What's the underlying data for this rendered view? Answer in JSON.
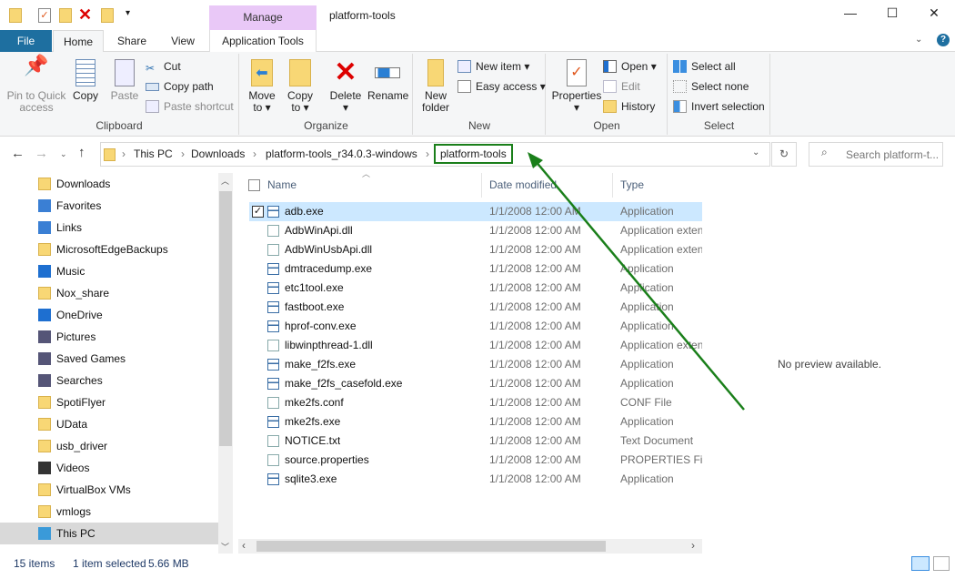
{
  "window": {
    "title": "platform-tools",
    "context_tab": "Manage",
    "minimize": "—",
    "maximize": "☐",
    "close": "✕"
  },
  "tabs": [
    {
      "label": "File"
    },
    {
      "label": "Home"
    },
    {
      "label": "Share"
    },
    {
      "label": "View"
    },
    {
      "label": "Application Tools"
    }
  ],
  "ribbon": {
    "clipboard": {
      "label": "Clipboard",
      "pin": "Pin to Quick access",
      "pin1": "Pin to Quick",
      "pin2": "access",
      "copy": "Copy",
      "paste": "Paste",
      "cut": "Cut",
      "copy_path": "Copy path",
      "paste_shortcut": "Paste shortcut"
    },
    "organize": {
      "label": "Organize",
      "move1": "Move",
      "move2": "to ▾",
      "copy1": "Copy",
      "copy2": "to ▾",
      "delete": "Delete",
      "delete_arrow": "▾",
      "rename": "Rename"
    },
    "new": {
      "label": "New",
      "new1": "New",
      "new2": "folder",
      "new_item": "New item ▾",
      "easy_access": "Easy access ▾"
    },
    "open": {
      "label": "Open",
      "properties": "Properties",
      "prop_arrow": "▾",
      "open": "Open ▾",
      "edit": "Edit",
      "history": "History"
    },
    "select": {
      "label": "Select",
      "all": "Select all",
      "none": "Select none",
      "invert": "Invert selection"
    }
  },
  "address": {
    "crumbs": [
      "This PC",
      "Downloads",
      "platform-tools_r34.0.3-windows",
      "platform-tools"
    ],
    "sep": "›",
    "search_placeholder": "Search platform-t..."
  },
  "nav": [
    {
      "label": "Downloads"
    },
    {
      "label": "Favorites"
    },
    {
      "label": "Links"
    },
    {
      "label": "MicrosoftEdgeBackups"
    },
    {
      "label": "Music"
    },
    {
      "label": "Nox_share"
    },
    {
      "label": "OneDrive"
    },
    {
      "label": "Pictures"
    },
    {
      "label": "Saved Games"
    },
    {
      "label": "Searches"
    },
    {
      "label": "SpotiFlyer"
    },
    {
      "label": "UData"
    },
    {
      "label": "usb_driver"
    },
    {
      "label": "Videos"
    },
    {
      "label": "VirtualBox VMs"
    },
    {
      "label": "vmlogs"
    },
    {
      "label": "This PC"
    }
  ],
  "columns": {
    "name": "Name",
    "date": "Date modified",
    "type": "Type"
  },
  "files": [
    {
      "name": "adb.exe",
      "date": "1/1/2008 12:00 AM",
      "type": "Application",
      "kind": "exe"
    },
    {
      "name": "AdbWinApi.dll",
      "date": "1/1/2008 12:00 AM",
      "type": "Application exten",
      "kind": "dll"
    },
    {
      "name": "AdbWinUsbApi.dll",
      "date": "1/1/2008 12:00 AM",
      "type": "Application exten",
      "kind": "dll"
    },
    {
      "name": "dmtracedump.exe",
      "date": "1/1/2008 12:00 AM",
      "type": "Application",
      "kind": "exe"
    },
    {
      "name": "etc1tool.exe",
      "date": "1/1/2008 12:00 AM",
      "type": "Application",
      "kind": "exe"
    },
    {
      "name": "fastboot.exe",
      "date": "1/1/2008 12:00 AM",
      "type": "Application",
      "kind": "exe"
    },
    {
      "name": "hprof-conv.exe",
      "date": "1/1/2008 12:00 AM",
      "type": "Application",
      "kind": "exe"
    },
    {
      "name": "libwinpthread-1.dll",
      "date": "1/1/2008 12:00 AM",
      "type": "Application exten",
      "kind": "dll"
    },
    {
      "name": "make_f2fs.exe",
      "date": "1/1/2008 12:00 AM",
      "type": "Application",
      "kind": "exe"
    },
    {
      "name": "make_f2fs_casefold.exe",
      "date": "1/1/2008 12:00 AM",
      "type": "Application",
      "kind": "exe"
    },
    {
      "name": "mke2fs.conf",
      "date": "1/1/2008 12:00 AM",
      "type": "CONF File",
      "kind": "file"
    },
    {
      "name": "mke2fs.exe",
      "date": "1/1/2008 12:00 AM",
      "type": "Application",
      "kind": "exe"
    },
    {
      "name": "NOTICE.txt",
      "date": "1/1/2008 12:00 AM",
      "type": "Text Document",
      "kind": "file"
    },
    {
      "name": "source.properties",
      "date": "1/1/2008 12:00 AM",
      "type": "PROPERTIES File",
      "kind": "file"
    },
    {
      "name": "sqlite3.exe",
      "date": "1/1/2008 12:00 AM",
      "type": "Application",
      "kind": "exe"
    }
  ],
  "preview": "No preview available.",
  "status": {
    "count": "15 items",
    "selected": "1 item selected",
    "size": "5.66 MB"
  },
  "colors": {
    "accent": "#1e6fa0",
    "annotation": "#1a7f1a",
    "selection": "#cce8ff"
  }
}
